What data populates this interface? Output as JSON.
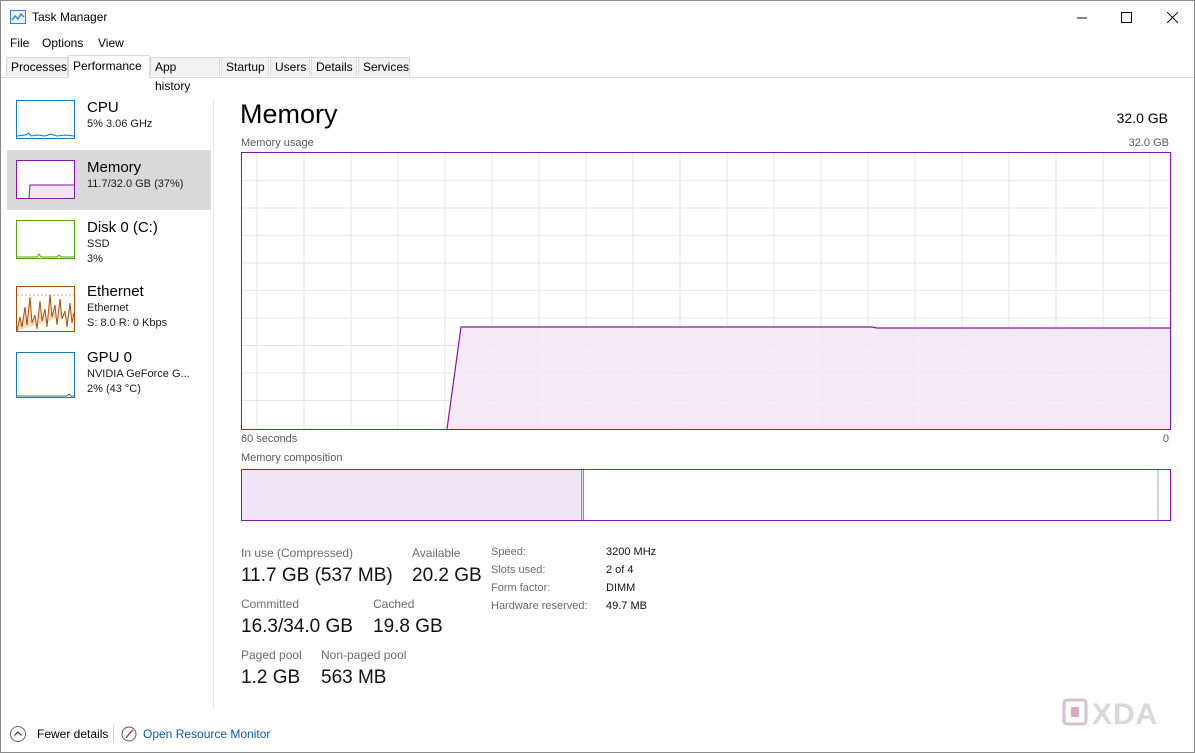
{
  "window": {
    "title": "Task Manager"
  },
  "menu": [
    "File",
    "Options",
    "View"
  ],
  "tabs": [
    "Processes",
    "Performance",
    "App history",
    "Startup",
    "Users",
    "Details",
    "Services"
  ],
  "sidebar": [
    {
      "name": "CPU",
      "line1": "5%  3.06 GHz",
      "line2": ""
    },
    {
      "name": "Memory",
      "line1": "11.7/32.0 GB (37%)",
      "line2": ""
    },
    {
      "name": "Disk 0 (C:)",
      "line1": "SSD",
      "line2": "3%"
    },
    {
      "name": "Ethernet",
      "line1": "Ethernet",
      "line2": "S: 8.0  R: 0 Kbps"
    },
    {
      "name": "GPU 0",
      "line1": "NVIDIA GeForce G...",
      "line2": "2%  (43 °C)"
    }
  ],
  "main": {
    "title": "Memory",
    "total": "32.0 GB",
    "usage_label": "Memory usage",
    "usage_max": "32.0 GB",
    "time_left": "60 seconds",
    "time_right": "0",
    "composition_label": "Memory composition"
  },
  "stats": {
    "in_use_label": "In use (Compressed)",
    "in_use_value": "11.7 GB (537 MB)",
    "available_label": "Available",
    "available_value": "20.2 GB",
    "committed_label": "Committed",
    "committed_value": "16.3/34.0 GB",
    "cached_label": "Cached",
    "cached_value": "19.8 GB",
    "paged_label": "Paged pool",
    "paged_value": "1.2 GB",
    "nonpaged_label": "Non-paged pool",
    "nonpaged_value": "563 MB"
  },
  "specs": [
    {
      "label": "Speed:",
      "value": "3200 MHz"
    },
    {
      "label": "Slots used:",
      "value": "2 of 4"
    },
    {
      "label": "Form factor:",
      "value": "DIMM"
    },
    {
      "label": "Hardware reserved:",
      "value": "49.7 MB"
    }
  ],
  "footer": {
    "fewer_details": "Fewer details",
    "open_resource_monitor": "Open Resource Monitor"
  },
  "watermark": "XDA",
  "colors": {
    "memory_accent": "#8b12ae",
    "cpu_accent": "#117dbb",
    "disk_accent": "#4da60c",
    "ethernet_accent": "#a74f01",
    "gpu_accent": "#117dbb"
  }
}
